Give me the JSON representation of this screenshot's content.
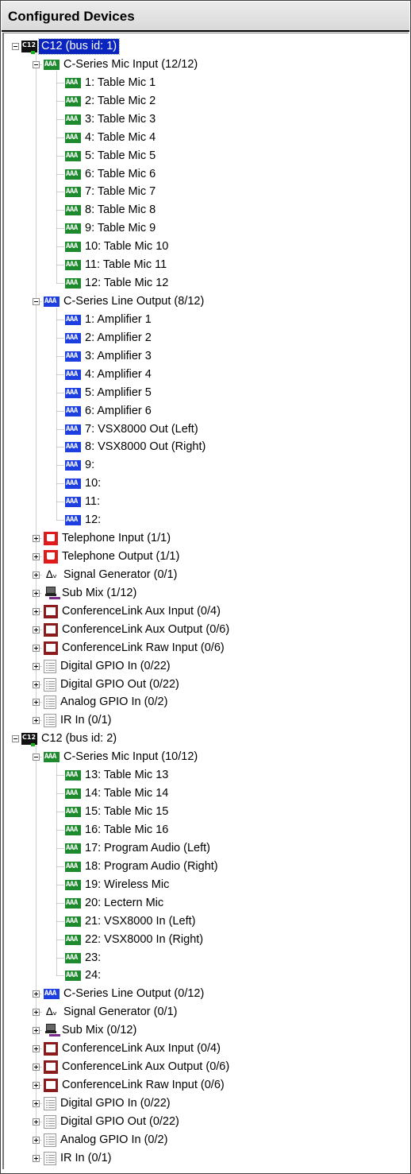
{
  "panel": {
    "title": "Configured Devices"
  },
  "tree": [
    {
      "label": "C12 (bus id: 1)",
      "icon": "c12-chip-icon",
      "level": 0,
      "expanded": true,
      "selected": true,
      "row": 0
    },
    {
      "label": "C-Series Mic Input (12/12)",
      "icon": "mic-input-icon",
      "level": 1,
      "expanded": true,
      "row": 1
    },
    {
      "label": "1: Table Mic 1",
      "icon": "mic-channel-icon",
      "level": 2,
      "row": 2
    },
    {
      "label": "2: Table Mic 2",
      "icon": "mic-channel-icon",
      "level": 2,
      "row": 3
    },
    {
      "label": "3: Table Mic 3",
      "icon": "mic-channel-icon",
      "level": 2,
      "row": 4
    },
    {
      "label": "4: Table Mic 4",
      "icon": "mic-channel-icon",
      "level": 2,
      "row": 5
    },
    {
      "label": "5: Table Mic 5",
      "icon": "mic-channel-icon",
      "level": 2,
      "row": 6
    },
    {
      "label": "6: Table Mic 6",
      "icon": "mic-channel-icon",
      "level": 2,
      "row": 7
    },
    {
      "label": "7: Table Mic 7",
      "icon": "mic-channel-icon",
      "level": 2,
      "row": 8
    },
    {
      "label": "8: Table Mic 8",
      "icon": "mic-channel-icon",
      "level": 2,
      "row": 9
    },
    {
      "label": "9: Table Mic 9",
      "icon": "mic-channel-icon",
      "level": 2,
      "row": 10
    },
    {
      "label": "10: Table Mic 10",
      "icon": "mic-channel-icon",
      "level": 2,
      "row": 11
    },
    {
      "label": "11: Table Mic 11",
      "icon": "mic-channel-icon",
      "level": 2,
      "row": 12
    },
    {
      "label": "12: Table Mic 12",
      "icon": "mic-channel-icon",
      "level": 2,
      "row": 13
    },
    {
      "label": "C-Series Line Output (8/12)",
      "icon": "line-output-icon",
      "level": 1,
      "expanded": true,
      "row": 14
    },
    {
      "label": "1: Amplifier 1",
      "icon": "output-channel-icon",
      "level": 2,
      "row": 15
    },
    {
      "label": "2: Amplifier 2",
      "icon": "output-channel-icon",
      "level": 2,
      "row": 16
    },
    {
      "label": "3: Amplifier 3",
      "icon": "output-channel-icon",
      "level": 2,
      "row": 17
    },
    {
      "label": "4: Amplifier 4",
      "icon": "output-channel-icon",
      "level": 2,
      "row": 18
    },
    {
      "label": "5: Amplifier 5",
      "icon": "output-channel-icon",
      "level": 2,
      "row": 19
    },
    {
      "label": "6: Amplifier 6",
      "icon": "output-channel-icon",
      "level": 2,
      "row": 20
    },
    {
      "label": "7: VSX8000 Out (Left)",
      "icon": "output-channel-icon",
      "level": 2,
      "row": 21
    },
    {
      "label": "8: VSX8000 Out (Right)",
      "icon": "output-channel-icon",
      "level": 2,
      "row": 22
    },
    {
      "label": "9:",
      "icon": "output-channel-icon",
      "level": 2,
      "row": 23
    },
    {
      "label": "10:",
      "icon": "output-channel-icon",
      "level": 2,
      "row": 24
    },
    {
      "label": "11:",
      "icon": "output-channel-icon",
      "level": 2,
      "row": 25
    },
    {
      "label": "12:",
      "icon": "output-channel-icon",
      "level": 2,
      "row": 26
    },
    {
      "label": "Telephone Input (1/1)",
      "icon": "telephone-input-icon",
      "level": 1,
      "expanded": false,
      "row": 27
    },
    {
      "label": "Telephone Output (1/1)",
      "icon": "telephone-output-icon",
      "level": 1,
      "expanded": false,
      "row": 28
    },
    {
      "label": "Signal Generator (0/1)",
      "icon": "signal-generator-icon",
      "level": 1,
      "expanded": false,
      "row": 29
    },
    {
      "label": "Sub Mix (1/12)",
      "icon": "sub-mix-icon",
      "level": 1,
      "expanded": false,
      "row": 30
    },
    {
      "label": "ConferenceLink Aux Input (0/4)",
      "icon": "conferencelink-icon",
      "level": 1,
      "expanded": false,
      "row": 31
    },
    {
      "label": "ConferenceLink Aux Output (0/6)",
      "icon": "conferencelink-icon",
      "level": 1,
      "expanded": false,
      "row": 32
    },
    {
      "label": "ConferenceLink Raw Input (0/6)",
      "icon": "conferencelink-icon",
      "level": 1,
      "expanded": false,
      "row": 33
    },
    {
      "label": "Digital GPIO In (0/22)",
      "icon": "gpio-icon",
      "level": 1,
      "expanded": false,
      "row": 34
    },
    {
      "label": "Digital GPIO Out (0/22)",
      "icon": "gpio-icon",
      "level": 1,
      "expanded": false,
      "row": 35
    },
    {
      "label": "Analog GPIO In (0/2)",
      "icon": "gpio-icon",
      "level": 1,
      "expanded": false,
      "row": 36
    },
    {
      "label": "IR In (0/1)",
      "icon": "gpio-icon",
      "level": 1,
      "expanded": false,
      "row": 37
    },
    {
      "label": "C12 (bus id: 2)",
      "icon": "c12-chip-icon",
      "level": 0,
      "expanded": true,
      "row": 38
    },
    {
      "label": "C-Series Mic Input (10/12)",
      "icon": "mic-input-icon",
      "level": 1,
      "expanded": true,
      "row": 39
    },
    {
      "label": "13: Table Mic 13",
      "icon": "mic-channel-icon",
      "level": 2,
      "row": 40
    },
    {
      "label": "14: Table Mic 14",
      "icon": "mic-channel-icon",
      "level": 2,
      "row": 41
    },
    {
      "label": "15: Table Mic 15",
      "icon": "mic-channel-icon",
      "level": 2,
      "row": 42
    },
    {
      "label": "16: Table Mic 16",
      "icon": "mic-channel-icon",
      "level": 2,
      "row": 43
    },
    {
      "label": "17: Program Audio (Left)",
      "icon": "mic-channel-icon",
      "level": 2,
      "row": 44
    },
    {
      "label": "18: Program Audio (Right)",
      "icon": "mic-channel-icon",
      "level": 2,
      "row": 45
    },
    {
      "label": "19: Wireless Mic",
      "icon": "mic-channel-icon",
      "level": 2,
      "row": 46
    },
    {
      "label": "20: Lectern Mic",
      "icon": "mic-channel-icon",
      "level": 2,
      "row": 47
    },
    {
      "label": "21: VSX8000 In (Left)",
      "icon": "mic-channel-icon",
      "level": 2,
      "row": 48
    },
    {
      "label": "22: VSX8000 In (Right)",
      "icon": "mic-channel-icon",
      "level": 2,
      "row": 49
    },
    {
      "label": "23:",
      "icon": "mic-channel-icon",
      "level": 2,
      "row": 50
    },
    {
      "label": "24:",
      "icon": "mic-channel-icon",
      "level": 2,
      "row": 51
    },
    {
      "label": "C-Series Line Output (0/12)",
      "icon": "line-output-icon",
      "level": 1,
      "expanded": false,
      "row": 52
    },
    {
      "label": "Signal Generator (0/1)",
      "icon": "signal-generator-icon",
      "level": 1,
      "expanded": false,
      "row": 53
    },
    {
      "label": "Sub Mix (0/12)",
      "icon": "sub-mix-icon",
      "level": 1,
      "expanded": false,
      "row": 54
    },
    {
      "label": "ConferenceLink Aux Input (0/4)",
      "icon": "conferencelink-icon",
      "level": 1,
      "expanded": false,
      "row": 55
    },
    {
      "label": "ConferenceLink Aux Output (0/6)",
      "icon": "conferencelink-icon",
      "level": 1,
      "expanded": false,
      "row": 56
    },
    {
      "label": "ConferenceLink Raw Input (0/6)",
      "icon": "conferencelink-icon",
      "level": 1,
      "expanded": false,
      "row": 57
    },
    {
      "label": "Digital GPIO In (0/22)",
      "icon": "gpio-icon",
      "level": 1,
      "expanded": false,
      "row": 58
    },
    {
      "label": "Digital GPIO Out (0/22)",
      "icon": "gpio-icon",
      "level": 1,
      "expanded": false,
      "row": 59
    },
    {
      "label": "Analog GPIO In (0/2)",
      "icon": "gpio-icon",
      "level": 1,
      "expanded": false,
      "row": 60
    },
    {
      "label": "IR In (0/1)",
      "icon": "gpio-icon",
      "level": 1,
      "expanded": false,
      "row": 61
    }
  ],
  "colors": {
    "selection": "#0a24c0",
    "mic_channel": "#1d8a2e",
    "line_output": "#1d3fe0",
    "telephone": "#e01a1a",
    "conferencelink": "#8b1a1a"
  }
}
